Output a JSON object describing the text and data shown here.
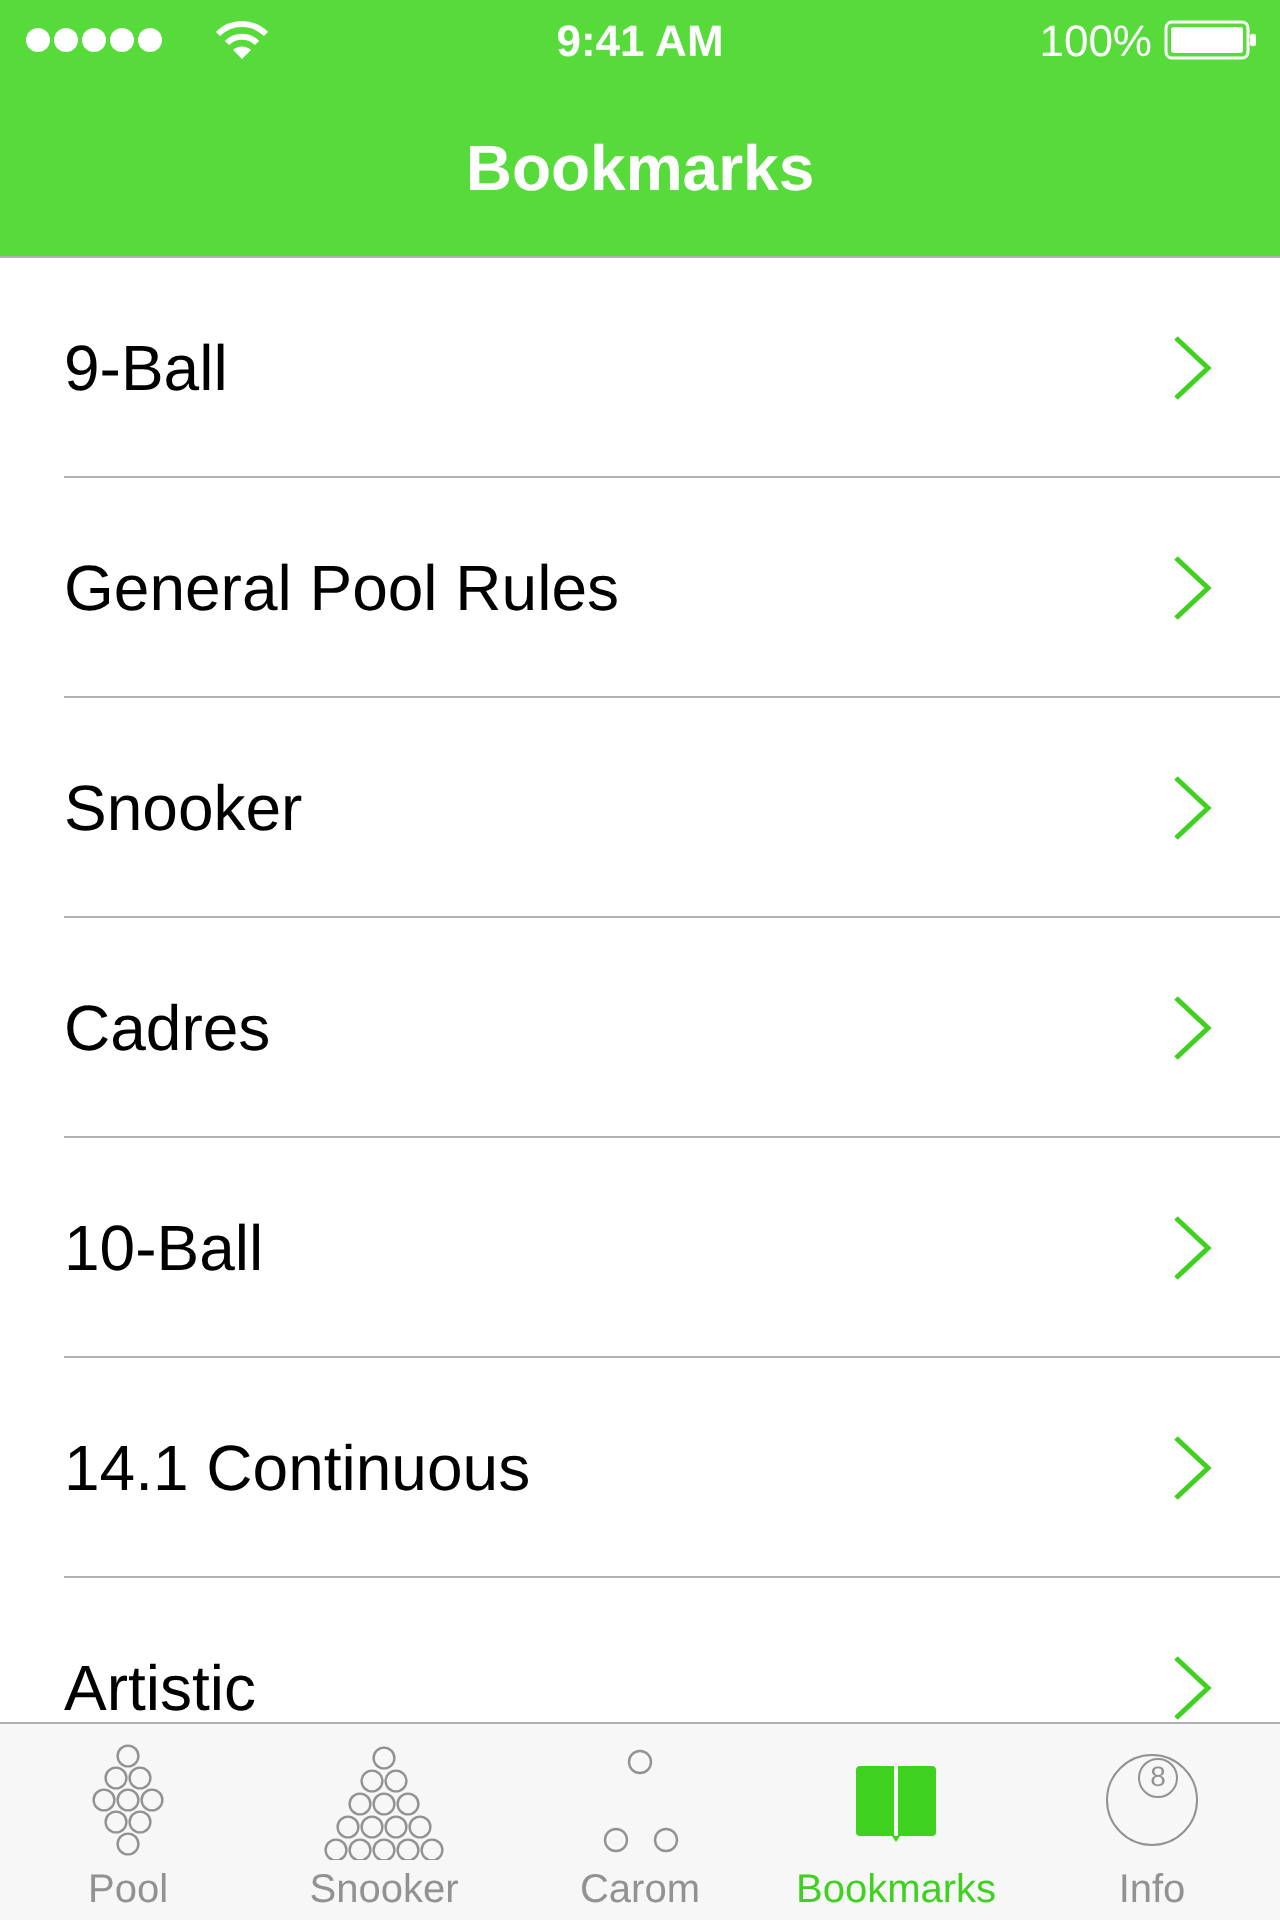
{
  "status_bar": {
    "time": "9:41 AM",
    "battery": "100%"
  },
  "nav_bar": {
    "title": "Bookmarks"
  },
  "rows": [
    {
      "label": "9-Ball"
    },
    {
      "label": "General Pool Rules"
    },
    {
      "label": "Snooker"
    },
    {
      "label": "Cadres"
    },
    {
      "label": "10-Ball"
    },
    {
      "label": "14.1 Continuous"
    },
    {
      "label": "Artistic"
    }
  ],
  "tab_bar": [
    {
      "kind": "pool",
      "label": "Pool",
      "selected": false
    },
    {
      "kind": "snooker",
      "label": "Snooker",
      "selected": false
    },
    {
      "kind": "carom",
      "label": "Carom",
      "selected": false
    },
    {
      "kind": "bookmarks",
      "label": "Bookmarks",
      "selected": true
    },
    {
      "kind": "info",
      "label": "Info",
      "icon_text": "8",
      "selected": false
    }
  ]
}
